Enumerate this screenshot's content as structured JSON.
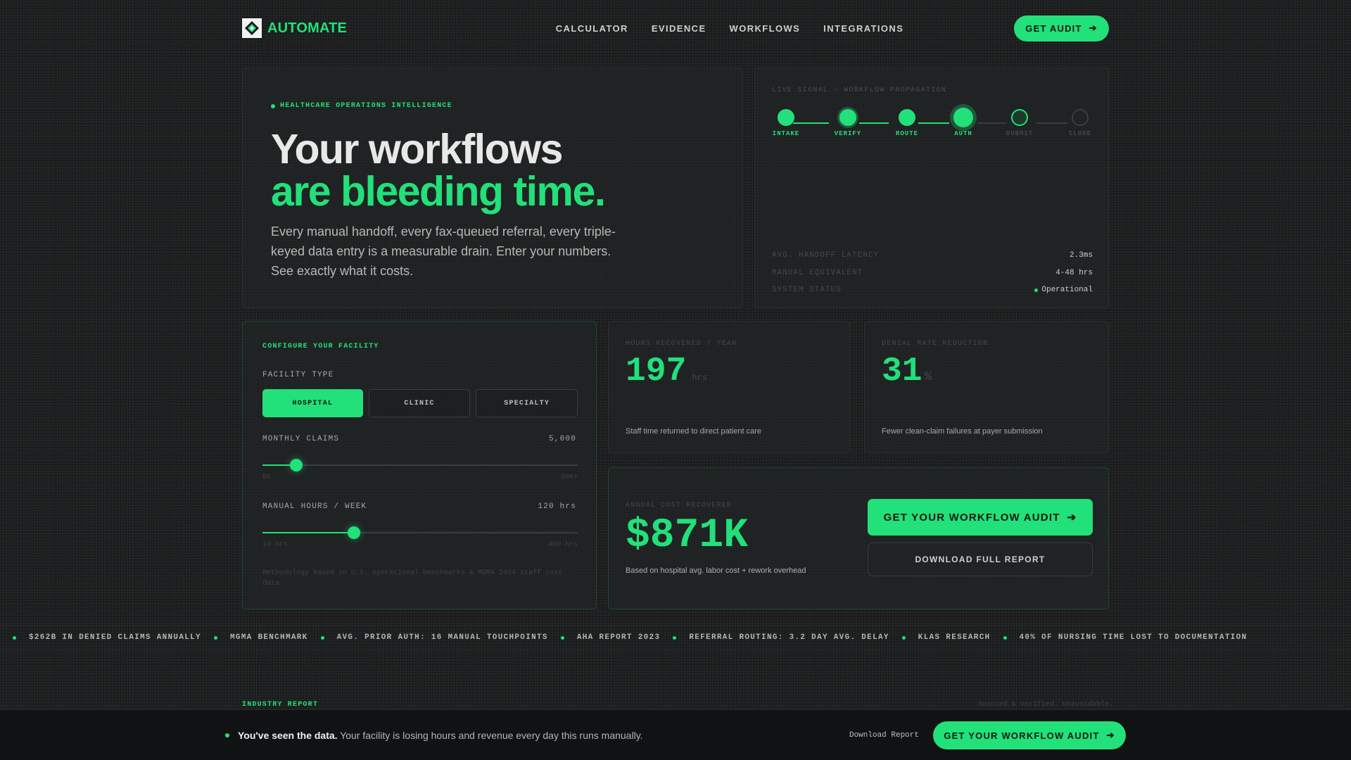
{
  "nav": {
    "brand": "AUTOMATE",
    "links": [
      "CALCULATOR",
      "EVIDENCE",
      "WORKFLOWS",
      "INTEGRATIONS"
    ],
    "cta": "GET AUDIT"
  },
  "hero": {
    "eyebrow": "HEALTHCARE OPERATIONS INTELLIGENCE",
    "headline_line1": "Your workflows",
    "headline_line2": "are bleeding time.",
    "lede": "Every manual handoff, every fax-queued referral, every triple-keyed data entry is a measurable drain. Enter your numbers. See exactly what it costs."
  },
  "signal": {
    "title": "LIVE SIGNAL — WORKFLOW PROPAGATION",
    "stages": [
      "INTAKE",
      "VERIFY",
      "ROUTE",
      "AUTH",
      "SUBMIT",
      "CLOSE"
    ],
    "rows": [
      {
        "key": "AVG. HANDOFF LATENCY",
        "value": "2.3ms"
      },
      {
        "key": "MANUAL EQUIVALENT",
        "value": "4-48 hrs"
      },
      {
        "key": "SYSTEM STATUS",
        "value": "Operational"
      }
    ]
  },
  "config": {
    "title": "CONFIGURE YOUR FACILITY",
    "facility_label": "FACILITY TYPE",
    "facility_options": [
      "HOSPITAL",
      "CLINIC",
      "SPECIALTY"
    ],
    "selected": "HOSPITAL",
    "claims_label": "MONTHLY CLAIMS",
    "claims_value": "5,000",
    "claims_fraction": 0.107,
    "claims_min": "5K",
    "claims_max": "50K+",
    "hours_label": "MANUAL HOURS / WEEK",
    "hours_value": "120 hrs",
    "hours_fraction": 0.29,
    "hours_min": "10 hrs",
    "hours_max": "400 hrs",
    "note": "Methodology based on U.S. operational benchmarks & MGMA 2024 staff cost data"
  },
  "metrics": [
    {
      "label": "HOURS RECOVERED / YEAR",
      "value": "197",
      "unit": "hrs",
      "desc": "Staff time returned to direct patient care"
    },
    {
      "label": "DENIAL RATE REDUCTION",
      "value": "31",
      "unit": "%",
      "desc": "Fewer clean-claim failures at payer submission"
    }
  ],
  "annual": {
    "label": "ANNUAL COST RECOVERED",
    "value": "$871K",
    "desc": "Based on hospital avg. labor cost + rework overhead",
    "cta": "GET YOUR WORKFLOW AUDIT",
    "download": "DOWNLOAD FULL REPORT"
  },
  "ticker": [
    "$262B IN DENIED CLAIMS ANNUALLY",
    "MGMA BENCHMARK",
    "AVG. PRIOR AUTH: 16 MANUAL TOUCHPOINTS",
    "AHA REPORT 2023",
    "REFERRAL ROUTING: 3.2 DAY AVG. DELAY",
    "KLAS RESEARCH",
    "40% OF NURSING TIME LOST TO DOCUMENTATION"
  ],
  "industry": {
    "label": "INDUSTRY REPORT",
    "source": "Sourced & verified. Unavoidable."
  },
  "footer": {
    "bold": "You've seen the data.",
    "text": "Your facility is losing hours and revenue every day this runs manually.",
    "link": "Download Report",
    "cta": "GET YOUR WORKFLOW AUDIT"
  },
  "colors": {
    "accent": "#22e07a",
    "background": "#1c1e1f",
    "bar": "#111213"
  }
}
